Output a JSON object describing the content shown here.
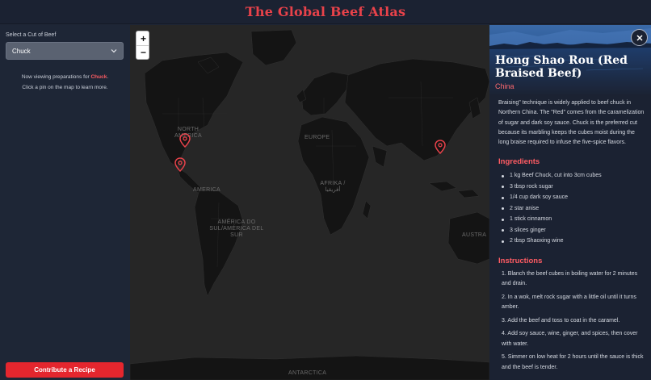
{
  "header": {
    "title": "The Global Beef Atlas"
  },
  "sidebar": {
    "select_label": "Select a Cut of Beef",
    "selected_cut": "Chuck",
    "viewing_prefix": "Now viewing preparations for ",
    "viewing_cut": "Chuck",
    "viewing_suffix": ".",
    "hint": "Click a pin on the map to learn more.",
    "contribute_label": "Contribute a Recipe"
  },
  "map": {
    "zoom_in": "+",
    "zoom_out": "−",
    "labels": {
      "north_america": "NORTH AMERICA",
      "europe": "EUROPE",
      "africa": "AFRIKA / أفريقيا",
      "south_america": "AMÉRICA DO SUL/AMÉRICA DEL SUR",
      "central_america": "AMERICA",
      "australia": "AUSTRA",
      "antarctica": "ANTARCTICA"
    },
    "pin_color": "#e8424a"
  },
  "recipe": {
    "title": "Hong Shao Rou (Red Braised Beef)",
    "country": "China",
    "description": "Braising\" technique is widely applied to beef chuck in Northern China. The \"Red\" comes from the caramelization of sugar and dark soy sauce. Chuck is the preferred cut because its marbling keeps the cubes moist during the long braise required to infuse the five-spice flavors.",
    "ingredients_heading": "Ingredients",
    "ingredients": [
      "1 kg Beef Chuck, cut into 3cm cubes",
      "3 tbsp rock sugar",
      "1/4 cup dark soy sauce",
      "2 star anise",
      "1 stick cinnamon",
      "3 slices ginger",
      "2 tbsp Shaoxing wine"
    ],
    "instructions_heading": "Instructions",
    "instructions": [
      "1. Blanch the beef cubes in boiling water for 2 minutes and drain.",
      "2. In a wok, melt rock sugar with a little oil until it turns amber.",
      "3. Add the beef and toss to coat in the caramel.",
      "4. Add soy sauce, wine, ginger, and spices, then cover with water.",
      "5. Simmer on low heat for 2 hours until the sauce is thick and the beef is tender."
    ]
  },
  "colors": {
    "accent": "#e8424a",
    "panel_bg": "#1b2232",
    "map_bg": "#262626",
    "land": "#141414"
  }
}
